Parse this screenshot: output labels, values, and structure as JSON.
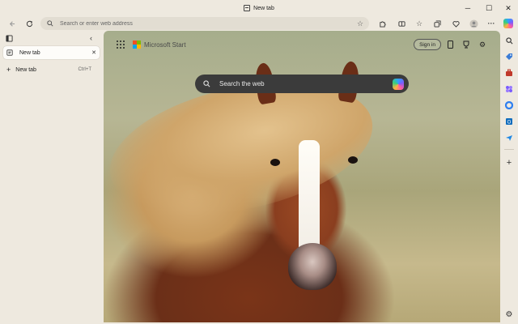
{
  "window": {
    "title": "New tab",
    "controls": {
      "minimize": "─",
      "maximize": "☐",
      "close": "✕"
    }
  },
  "toolbar": {
    "address_placeholder": "Search or enter web address",
    "icons": [
      "back-icon",
      "refresh-icon",
      "star-icon",
      "extensions-icon",
      "split-screen-icon",
      "favorites-icon",
      "collections-icon",
      "browser-essentials-icon",
      "profile-icon",
      "more-icon",
      "copilot-icon"
    ]
  },
  "vertical_tabs": {
    "tabs": [
      {
        "label": "New tab"
      }
    ],
    "new_tab_label": "New tab",
    "new_tab_shortcut": "Ctrl+T"
  },
  "newtab_page": {
    "brand": "Microsoft Start",
    "sign_in": "Sign in",
    "search_placeholder": "Search the web"
  },
  "colors": {
    "frame": "#eee9df",
    "address_bg": "#e2ddd2",
    "search_bg": "#3b3b3b",
    "ms_red": "#f25022",
    "ms_green": "#7fba00",
    "ms_blue": "#00a4ef",
    "ms_yellow": "#ffb900"
  },
  "right_sidebar": {
    "icons": [
      "copilot-sidebar-icon",
      "search-sidebar-icon",
      "shopping-icon",
      "tools-icon",
      "games-icon",
      "microsoft-365-icon",
      "outlook-icon",
      "drop-icon",
      "add-icon",
      "settings-icon"
    ]
  }
}
